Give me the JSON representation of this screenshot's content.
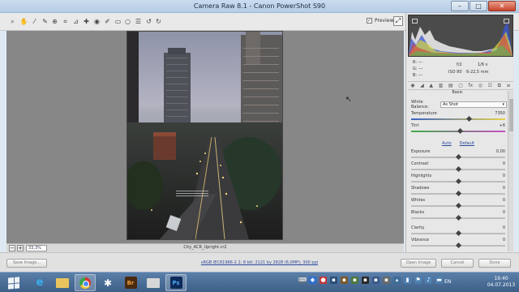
{
  "window": {
    "title": "Camera Raw 8.1  -  Canon PowerShot S90",
    "minimize": "–",
    "maximize": "□",
    "close": "✕"
  },
  "toolbar": {
    "tools": [
      "zoom-icon",
      "hand-icon",
      "white-balance-icon",
      "color-sampler-icon",
      "target-adjust-icon",
      "crop-icon",
      "straighten-icon",
      "spot-removal-icon",
      "red-eye-icon",
      "adjustment-brush-icon",
      "graduated-filter-icon",
      "radial-filter-icon",
      "preferences-icon",
      "rotate-ccw-icon",
      "rotate-cw-icon"
    ],
    "preview_label": "Preview",
    "preview_checked": true
  },
  "zoom": {
    "value": "33,3%",
    "filename": "City_ACR_Upright.cr2"
  },
  "readout": {
    "r": "R:",
    "g": "G:",
    "b": "B:",
    "dash": "---",
    "aperture": "f/2",
    "shutter": "1/6 s",
    "iso": "ISO 80",
    "focal": "6-22,5 mm"
  },
  "panel": {
    "section": "Basic",
    "white_balance_label": "White Balance:",
    "white_balance_value": "As Shot",
    "auto": "Auto",
    "default": "Default",
    "sliders": [
      {
        "label": "Temperature",
        "value": "7350",
        "pos": 0.62,
        "kind": "temp"
      },
      {
        "label": "Tint",
        "value": "+6",
        "pos": 0.52,
        "kind": "tint"
      },
      {
        "label": "Exposure",
        "value": "0,00",
        "pos": 0.5,
        "kind": ""
      },
      {
        "label": "Contrast",
        "value": "0",
        "pos": 0.5,
        "kind": ""
      },
      {
        "label": "Highlights",
        "value": "0",
        "pos": 0.5,
        "kind": ""
      },
      {
        "label": "Shadows",
        "value": "0",
        "pos": 0.5,
        "kind": ""
      },
      {
        "label": "Whites",
        "value": "0",
        "pos": 0.5,
        "kind": ""
      },
      {
        "label": "Blacks",
        "value": "0",
        "pos": 0.5,
        "kind": ""
      },
      {
        "label": "Clarity",
        "value": "0",
        "pos": 0.5,
        "kind": ""
      },
      {
        "label": "Vibrance",
        "value": "0",
        "pos": 0.5,
        "kind": ""
      }
    ]
  },
  "bottom": {
    "save": "Save Image...",
    "workflow": "sRGB IEC61966-2.1; 8 bit; 2121 by 2828 (6,0MP); 300 ppi",
    "open": "Open Image",
    "cancel": "Cancel",
    "done": "Done"
  },
  "taskbar": {
    "bridge": "Br",
    "photoshop": "Ps",
    "lang": "EN",
    "time": "19:40",
    "date": "04.07.2013"
  },
  "colors": {
    "photoshop": "#0d2a5b",
    "bridge": "#4a2a10"
  }
}
